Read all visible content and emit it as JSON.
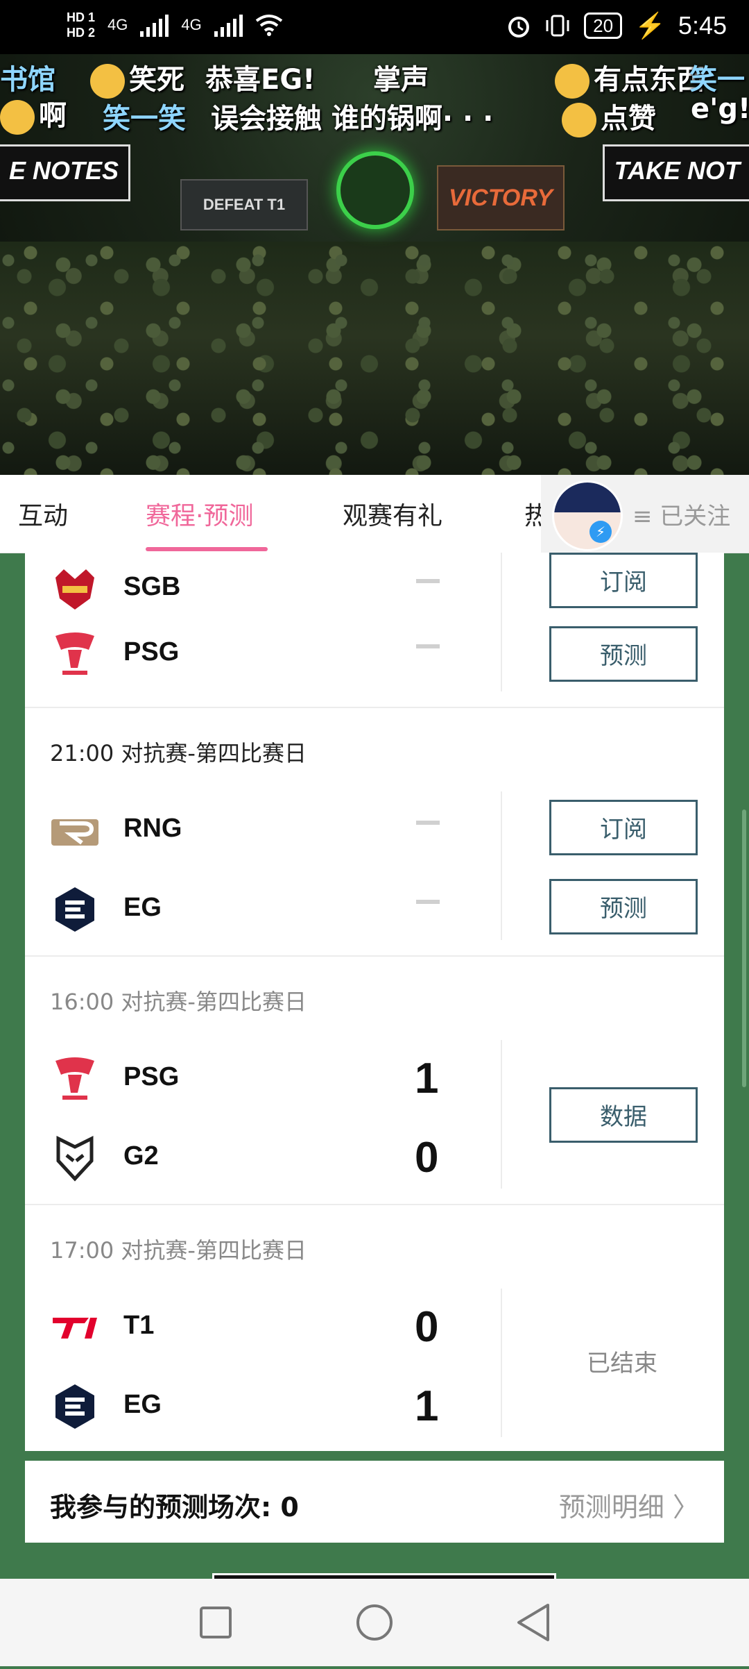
{
  "status_bar": {
    "hd1": "HD 1",
    "hd2": "HD 2",
    "net1": "4G",
    "net2": "4G",
    "battery": "20",
    "time": "5:45"
  },
  "video": {
    "danmaku": [
      {
        "text": "书馆",
        "style": "blue"
      },
      {
        "text": "笑死",
        "style": "white"
      },
      {
        "text": "恭喜EG!",
        "style": "white"
      },
      {
        "text": "掌声",
        "style": "white"
      },
      {
        "text": "有点东西",
        "style": "white"
      },
      {
        "text": "笑一",
        "style": "blue"
      },
      {
        "text": "啊",
        "style": "white"
      },
      {
        "text": "笑一笑",
        "style": "blue"
      },
      {
        "text": "误会接触 谁的锅啊· · ·",
        "style": "white"
      },
      {
        "text": "点赞",
        "style": "white"
      },
      {
        "text": "e'g!!!",
        "style": "white"
      }
    ],
    "side_sign_left": "E NOTES",
    "side_sign_right": "TAKE NOT",
    "screen_left": "DEFEAT T1",
    "screen_right": "VICTORY"
  },
  "tabs": [
    {
      "label": "互动",
      "active": false
    },
    {
      "label": "赛程·预测",
      "active": true
    },
    {
      "label": "观赛有礼",
      "active": false
    },
    {
      "label": "热",
      "active": false
    }
  ],
  "follow": {
    "label": "≡ 已关注",
    "badge": "⚡"
  },
  "matches": [
    {
      "header": "",
      "teams": [
        {
          "name": "SGB",
          "score": null,
          "logo_color": "#c0172a"
        },
        {
          "name": "PSG",
          "score": null,
          "logo_color": "#e0334b"
        }
      ],
      "buttons": [
        "订阅",
        "预测"
      ],
      "status": null
    },
    {
      "header": "21:00  对抗赛-第四比赛日",
      "teams": [
        {
          "name": "RNG",
          "score": null,
          "logo_color": "#b59a78"
        },
        {
          "name": "EG",
          "score": null,
          "logo_color": "#0f1c3a"
        }
      ],
      "buttons": [
        "订阅",
        "预测"
      ],
      "status": null
    },
    {
      "header": "16:00  对抗赛-第四比赛日",
      "teams": [
        {
          "name": "PSG",
          "score": "1",
          "logo_color": "#e0334b"
        },
        {
          "name": "G2",
          "score": "0",
          "logo_color": "#222222"
        }
      ],
      "buttons": [
        "数据"
      ],
      "status": null
    },
    {
      "header": "17:00  对抗赛-第四比赛日",
      "teams": [
        {
          "name": "T1",
          "score": "0",
          "logo_color": "#e2012d"
        },
        {
          "name": "EG",
          "score": "1",
          "logo_color": "#0f1c3a"
        }
      ],
      "buttons": [],
      "status": "已结束"
    }
  ],
  "predict_bar": {
    "label": "我参与的预测场次: 0",
    "detail": "预测明细 〉"
  },
  "colors": {
    "accent": "#f0679a",
    "button_border": "#3a5e6c",
    "page_bg": "#3f7a4c"
  }
}
